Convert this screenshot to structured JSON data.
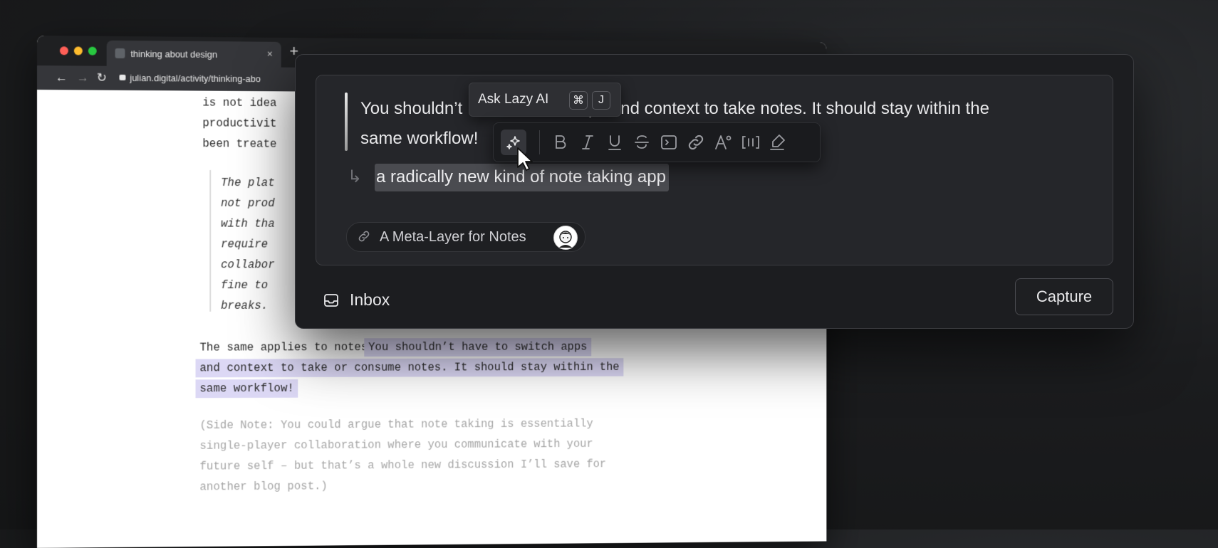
{
  "browser": {
    "tab_title": "thinking about design",
    "tab_close": "×",
    "new_tab": "+",
    "url": "julian.digital/activity/thinking-abo",
    "back": "←",
    "forward": "→",
    "reload": "↻"
  },
  "article": {
    "lines_top": [
      "is not idea",
      "productivit",
      "been treate"
    ],
    "quote_lines": [
      "The plat",
      "not prod",
      "with tha",
      "require",
      "collabor",
      "fine to",
      "breaks."
    ],
    "para_lead": "The same applies to notes.",
    "para_hl_1": "You shouldn’t have to switch apps",
    "para_hl_2": "and context to take or consume notes. It should stay within the",
    "para_hl_3": "same workflow!",
    "side_note": [
      "(Side Note: You could argue that note taking is essentially",
      "single-player collaboration where you communicate with your",
      "future self – but that’s a whole new discussion I’ll save for",
      "another blog post.)"
    ]
  },
  "capture": {
    "note_part1": "You shouldn’t",
    "note_part2": " ps and context to take notes. It should stay within the",
    "note_part3": "same workflow!",
    "ai_suggestion": "a radically new kind of note taking app",
    "link_title": "A Meta-Layer for Notes",
    "inbox_label": "Inbox",
    "capture_label": "Capture"
  },
  "ask_ai": {
    "label": "Ask Lazy AI",
    "key_cmd": "⌘",
    "key_j": "J"
  },
  "colors": {
    "highlight": "#dcd8f5",
    "modal_bg": "#1c1d20",
    "editor_bg": "#25262a"
  }
}
